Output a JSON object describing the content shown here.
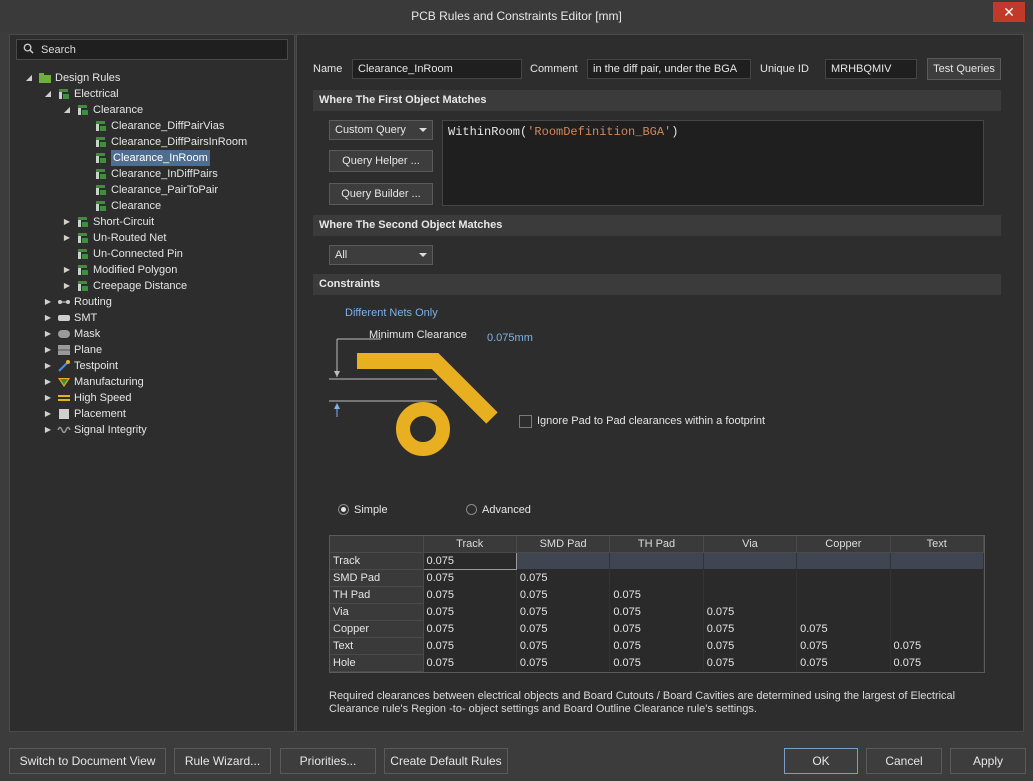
{
  "window": {
    "title": "PCB Rules and Constraints Editor [mm]",
    "close_label": "✕"
  },
  "search": {
    "placeholder": "Search"
  },
  "tree": {
    "root": "Design Rules",
    "electrical": "Electrical",
    "clearance": "Clearance",
    "clearance_rules": [
      "Clearance_DiffPairVias",
      "Clearance_DiffPairsInRoom",
      "Clearance_InRoom",
      "Clearance_InDiffPairs",
      "Clearance_PairToPair",
      "Clearance"
    ],
    "electrical_other": [
      "Short-Circuit",
      "Un-Routed Net",
      "Un-Connected Pin",
      "Modified Polygon",
      "Creepage Distance"
    ],
    "categories": [
      "Routing",
      "SMT",
      "Mask",
      "Plane",
      "Testpoint",
      "Manufacturing",
      "High Speed",
      "Placement",
      "Signal Integrity"
    ]
  },
  "rule": {
    "name_label": "Name",
    "name_value": "Clearance_InRoom",
    "comment_label": "Comment",
    "comment_value": "in the diff pair, under the BGA",
    "uid_label": "Unique ID",
    "uid_value": "MRHBQMIV",
    "test_queries": "Test Queries"
  },
  "first_match": {
    "header": "Where The First Object Matches",
    "mode": "Custom Query",
    "query_helper": "Query Helper ...",
    "query_builder": "Query Builder ...",
    "query_fn": "WithinRoom(",
    "query_arg": "'RoomDefinition_BGA'",
    "query_close": ")"
  },
  "second_match": {
    "header": "Where The Second Object Matches",
    "mode": "All"
  },
  "constraints": {
    "header": "Constraints",
    "nets": "Different Nets Only",
    "min_clearance_label": "Minimum Clearance",
    "min_clearance_value": "0.075mm",
    "ignore_pad": "Ignore Pad to Pad clearances within a footprint",
    "simple": "Simple",
    "advanced": "Advanced",
    "mode_selected": "Simple",
    "trace_color": "#e8b020"
  },
  "grid": {
    "columns": [
      "Track",
      "SMD Pad",
      "TH Pad",
      "Via",
      "Copper",
      "Text"
    ],
    "rows": [
      {
        "name": "Track",
        "values": [
          "0.075"
        ]
      },
      {
        "name": "SMD Pad",
        "values": [
          "0.075",
          "0.075"
        ]
      },
      {
        "name": "TH Pad",
        "values": [
          "0.075",
          "0.075",
          "0.075"
        ]
      },
      {
        "name": "Via",
        "values": [
          "0.075",
          "0.075",
          "0.075",
          "0.075"
        ]
      },
      {
        "name": "Copper",
        "values": [
          "0.075",
          "0.075",
          "0.075",
          "0.075",
          "0.075"
        ]
      },
      {
        "name": "Text",
        "values": [
          "0.075",
          "0.075",
          "0.075",
          "0.075",
          "0.075",
          "0.075"
        ]
      },
      {
        "name": "Hole",
        "values": [
          "0.075",
          "0.075",
          "0.075",
          "0.075",
          "0.075",
          "0.075"
        ]
      }
    ]
  },
  "note": "Required clearances between electrical objects and Board Cutouts / Board Cavities are determined using the largest of Electrical Clearance rule's Region -to- object settings and Board Outline Clearance rule's settings.",
  "footer": {
    "switch_view": "Switch to Document View",
    "rule_wizard": "Rule Wizard...",
    "priorities": "Priorities...",
    "create_defaults": "Create Default Rules",
    "ok": "OK",
    "cancel": "Cancel",
    "apply": "Apply"
  }
}
